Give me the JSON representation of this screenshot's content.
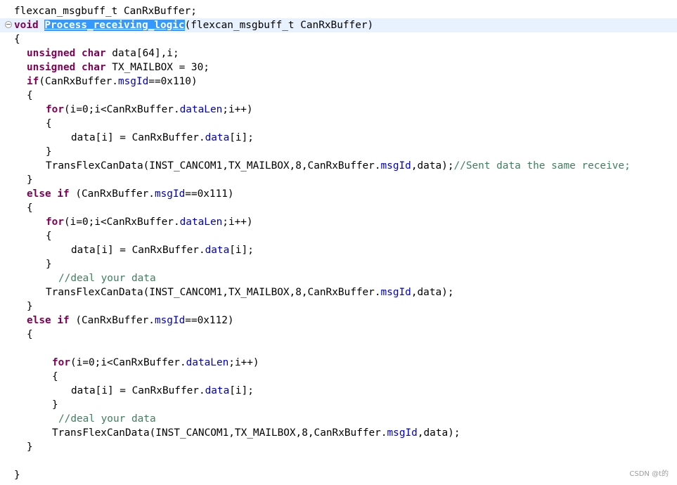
{
  "lines": [
    {
      "indent": 20,
      "tokens": [
        {
          "t": "flexcan_msgbuff_t CanRxBuffer;",
          "c": ""
        }
      ]
    },
    {
      "indent": 20,
      "current": true,
      "marker": true,
      "tokens": [
        {
          "t": "void",
          "c": "kw"
        },
        {
          "t": " ",
          "c": ""
        },
        {
          "t": "Process_receiving_logic",
          "c": "sel"
        },
        {
          "t": "(flexcan_msgbuff_t CanRxBuffer)",
          "c": ""
        }
      ]
    },
    {
      "indent": 20,
      "tokens": [
        {
          "t": "{",
          "c": ""
        }
      ]
    },
    {
      "indent": 38,
      "tokens": [
        {
          "t": "unsigned",
          "c": "kw"
        },
        {
          "t": " ",
          "c": ""
        },
        {
          "t": "char",
          "c": "kw"
        },
        {
          "t": " data[64],i;",
          "c": ""
        }
      ]
    },
    {
      "indent": 38,
      "tokens": [
        {
          "t": "unsigned",
          "c": "kw"
        },
        {
          "t": " ",
          "c": ""
        },
        {
          "t": "char",
          "c": "kw"
        },
        {
          "t": " TX_MAILBOX = 30;",
          "c": ""
        }
      ]
    },
    {
      "indent": 38,
      "tokens": [
        {
          "t": "if",
          "c": "kw"
        },
        {
          "t": "(CanRxBuffer.",
          "c": ""
        },
        {
          "t": "msgId",
          "c": "fld"
        },
        {
          "t": "==0x110)",
          "c": ""
        }
      ]
    },
    {
      "indent": 38,
      "tokens": [
        {
          "t": "{",
          "c": ""
        }
      ]
    },
    {
      "indent": 65,
      "tokens": [
        {
          "t": "for",
          "c": "kw"
        },
        {
          "t": "(i=0;i<CanRxBuffer.",
          "c": ""
        },
        {
          "t": "dataLen",
          "c": "fld"
        },
        {
          "t": ";i++)",
          "c": ""
        }
      ]
    },
    {
      "indent": 65,
      "tokens": [
        {
          "t": "{",
          "c": ""
        }
      ]
    },
    {
      "indent": 101,
      "tokens": [
        {
          "t": "data[i] = CanRxBuffer.",
          "c": ""
        },
        {
          "t": "data",
          "c": "fld"
        },
        {
          "t": "[i];",
          "c": ""
        }
      ]
    },
    {
      "indent": 65,
      "tokens": [
        {
          "t": "}",
          "c": ""
        }
      ]
    },
    {
      "indent": 65,
      "tokens": [
        {
          "t": "TransFlexCanData(INST_CANCOM1,TX_MAILBOX,8,CanRxBuffer.",
          "c": ""
        },
        {
          "t": "msgId",
          "c": "fld"
        },
        {
          "t": ",data);",
          "c": ""
        },
        {
          "t": "//Sent data the same receive;",
          "c": "cmt"
        }
      ]
    },
    {
      "indent": 38,
      "tokens": [
        {
          "t": "}",
          "c": ""
        }
      ]
    },
    {
      "indent": 38,
      "tokens": [
        {
          "t": "else",
          "c": "kw"
        },
        {
          "t": " ",
          "c": ""
        },
        {
          "t": "if",
          "c": "kw"
        },
        {
          "t": " (CanRxBuffer.",
          "c": ""
        },
        {
          "t": "msgId",
          "c": "fld"
        },
        {
          "t": "==0x111)",
          "c": ""
        }
      ]
    },
    {
      "indent": 38,
      "tokens": [
        {
          "t": "{",
          "c": ""
        }
      ]
    },
    {
      "indent": 65,
      "tokens": [
        {
          "t": "for",
          "c": "kw"
        },
        {
          "t": "(i=0;i<CanRxBuffer.",
          "c": ""
        },
        {
          "t": "dataLen",
          "c": "fld"
        },
        {
          "t": ";i++)",
          "c": ""
        }
      ]
    },
    {
      "indent": 65,
      "tokens": [
        {
          "t": "{",
          "c": ""
        }
      ]
    },
    {
      "indent": 101,
      "tokens": [
        {
          "t": "data[i] = CanRxBuffer.",
          "c": ""
        },
        {
          "t": "data",
          "c": "fld"
        },
        {
          "t": "[i];",
          "c": ""
        }
      ]
    },
    {
      "indent": 65,
      "tokens": [
        {
          "t": "}",
          "c": ""
        }
      ]
    },
    {
      "indent": 83,
      "tokens": [
        {
          "t": "//deal your data",
          "c": "cmt"
        }
      ]
    },
    {
      "indent": 65,
      "tokens": [
        {
          "t": "TransFlexCanData(INST_CANCOM1,TX_MAILBOX,8,CanRxBuffer.",
          "c": ""
        },
        {
          "t": "msgId",
          "c": "fld"
        },
        {
          "t": ",data);",
          "c": ""
        }
      ]
    },
    {
      "indent": 38,
      "tokens": [
        {
          "t": "}",
          "c": ""
        }
      ]
    },
    {
      "indent": 38,
      "tokens": [
        {
          "t": "else",
          "c": "kw"
        },
        {
          "t": " ",
          "c": ""
        },
        {
          "t": "if",
          "c": "kw"
        },
        {
          "t": " (CanRxBuffer.",
          "c": ""
        },
        {
          "t": "msgId",
          "c": "fld"
        },
        {
          "t": "==0x112)",
          "c": ""
        }
      ]
    },
    {
      "indent": 38,
      "tokens": [
        {
          "t": "{",
          "c": ""
        }
      ]
    },
    {
      "indent": 38,
      "tokens": []
    },
    {
      "indent": 74,
      "tokens": [
        {
          "t": "for",
          "c": "kw"
        },
        {
          "t": "(i=0;i<CanRxBuffer.",
          "c": ""
        },
        {
          "t": "dataLen",
          "c": "fld"
        },
        {
          "t": ";i++)",
          "c": ""
        }
      ]
    },
    {
      "indent": 74,
      "tokens": [
        {
          "t": "{",
          "c": ""
        }
      ]
    },
    {
      "indent": 101,
      "tokens": [
        {
          "t": "data[i] = CanRxBuffer.",
          "c": ""
        },
        {
          "t": "data",
          "c": "fld"
        },
        {
          "t": "[i];",
          "c": ""
        }
      ]
    },
    {
      "indent": 74,
      "tokens": [
        {
          "t": "}",
          "c": ""
        }
      ]
    },
    {
      "indent": 83,
      "tokens": [
        {
          "t": "//deal your data",
          "c": "cmt"
        }
      ]
    },
    {
      "indent": 74,
      "tokens": [
        {
          "t": "TransFlexCanData(INST_CANCOM1,TX_MAILBOX,8,CanRxBuffer.",
          "c": ""
        },
        {
          "t": "msgId",
          "c": "fld"
        },
        {
          "t": ",data);",
          "c": ""
        }
      ]
    },
    {
      "indent": 38,
      "tokens": [
        {
          "t": "}",
          "c": ""
        }
      ]
    },
    {
      "indent": 20,
      "tokens": []
    },
    {
      "indent": 20,
      "tokens": [
        {
          "t": "}",
          "c": ""
        }
      ]
    }
  ],
  "watermark": "CSDN @t的",
  "colors": {
    "keyword": "#7f0055",
    "field": "#0000c0",
    "comment": "#3f7f5f",
    "selection": "#3399ff",
    "current_line": "#e8f2fe"
  }
}
